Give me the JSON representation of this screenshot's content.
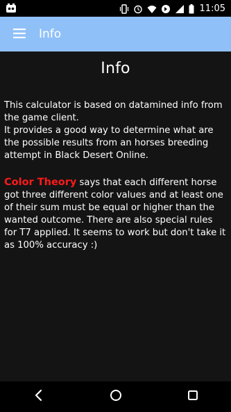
{
  "status_bar": {
    "time": "11:05",
    "icons": [
      "notification-app-icon",
      "vibrate-icon",
      "alarm-icon",
      "wifi-icon",
      "data-saver-icon",
      "signal-icon",
      "battery-icon"
    ]
  },
  "app_bar": {
    "title": "Info",
    "menu_icon": "hamburger-menu-icon",
    "color": "#90c0f8"
  },
  "content": {
    "heading": "Info",
    "paragraph1": "This calculator is based on datamined info from the game client.\nIt provides a good way to determine what are the possible results from an horses breeding attempt in Black Desert Online.",
    "paragraph2_highlight": "Color Theory",
    "paragraph2_text": " says that each different horse got three different color values and at least one of their sum must be equal or higher than the wanted outcome. There are also special rules for T7 applied. It seems to work but don't take it as 100% accuracy :)",
    "highlight_color": "#ff1a1a"
  },
  "nav_bar": {
    "buttons": [
      "back-icon",
      "home-icon",
      "recents-icon"
    ]
  }
}
